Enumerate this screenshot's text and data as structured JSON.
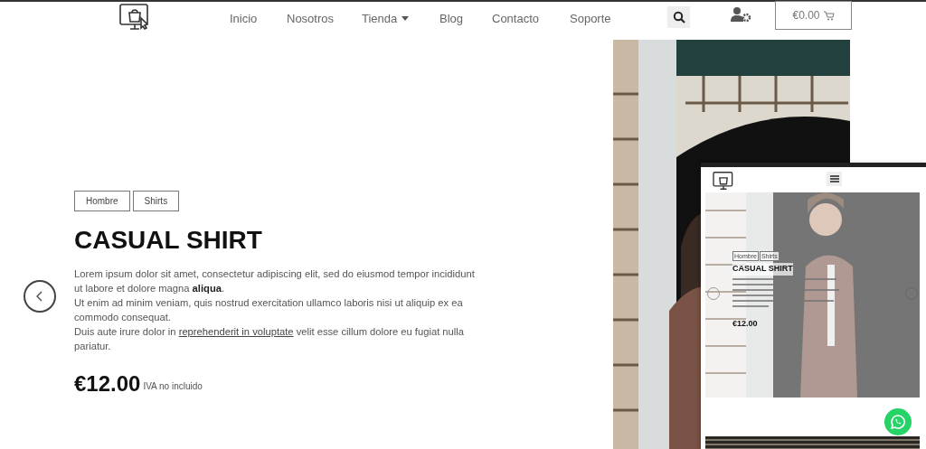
{
  "header": {
    "nav": [
      {
        "label": "Inicio",
        "has_dropdown": false
      },
      {
        "label": "Nosotros",
        "has_dropdown": false
      },
      {
        "label": "Tienda",
        "has_dropdown": true
      },
      {
        "label": "Blog",
        "has_dropdown": false
      },
      {
        "label": "Contacto",
        "has_dropdown": false
      },
      {
        "label": "Soporte",
        "has_dropdown": false
      }
    ],
    "cart_total": "€0.00"
  },
  "hero": {
    "tags": [
      "Hombre",
      "Shirts"
    ],
    "title": "CASUAL SHIRT",
    "paragraphs": [
      "Lorem ipsum dolor sit amet, consectetur adipiscing elit, sed do eiusmod tempor incididunt ut labore et dolore magna **aliqua**.",
      "Ut enim ad minim veniam, quis nostrud exercitation ullamco laboris nisi ut aliquip ex ea commodo consequat."
    ],
    "link_paragraph": {
      "before": "Duis aute irure dolor in ",
      "link": "reprehenderit in voluptate",
      "after": " velit esse cillum dolore eu fugiat nulla pariatur."
    },
    "price": "€12.00",
    "tax_note": "IVA no incluido"
  },
  "mobile_preview": {
    "tags": [
      "Hombre",
      "Shirts"
    ],
    "title": "CASUAL SHIRT",
    "price": "€12.00"
  }
}
